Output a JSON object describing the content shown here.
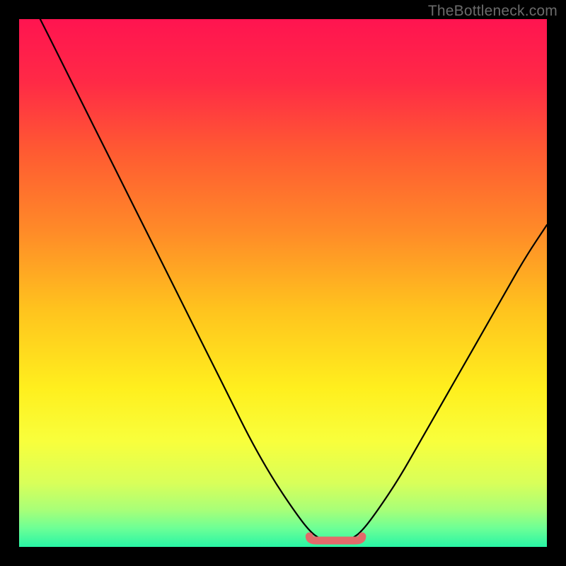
{
  "watermark": "TheBottleneck.com",
  "chart_data": {
    "type": "line",
    "title": "",
    "xlabel": "",
    "ylabel": "",
    "xlim": [
      0,
      100
    ],
    "ylim": [
      0,
      100
    ],
    "grid": false,
    "legend": false,
    "series": [
      {
        "name": "bottleneck-curve",
        "x": [
          4,
          8,
          12,
          16,
          20,
          24,
          28,
          32,
          36,
          40,
          44,
          48,
          52,
          55,
          57,
          59,
          61,
          63,
          65,
          68,
          72,
          76,
          80,
          84,
          88,
          92,
          96,
          100
        ],
        "y": [
          100,
          92,
          84,
          76,
          68,
          60,
          52,
          44,
          36,
          28,
          20,
          13,
          7,
          3,
          1.5,
          1,
          1,
          1.5,
          3,
          7,
          13,
          20,
          27,
          34,
          41,
          48,
          55,
          61
        ]
      }
    ],
    "highlight": {
      "name": "optimal-range",
      "x_start": 55,
      "x_end": 65,
      "y": 1.2,
      "color": "#e26a6a"
    },
    "background_gradient": {
      "stops": [
        {
          "pos": 0.0,
          "color": "#ff1450"
        },
        {
          "pos": 0.12,
          "color": "#ff2a46"
        },
        {
          "pos": 0.25,
          "color": "#ff5a32"
        },
        {
          "pos": 0.4,
          "color": "#ff8a28"
        },
        {
          "pos": 0.55,
          "color": "#ffc31e"
        },
        {
          "pos": 0.7,
          "color": "#ffef1e"
        },
        {
          "pos": 0.8,
          "color": "#f8ff3c"
        },
        {
          "pos": 0.88,
          "color": "#d8ff5a"
        },
        {
          "pos": 0.93,
          "color": "#a8ff78"
        },
        {
          "pos": 0.965,
          "color": "#6cff96"
        },
        {
          "pos": 1.0,
          "color": "#28f5a5"
        }
      ]
    }
  }
}
